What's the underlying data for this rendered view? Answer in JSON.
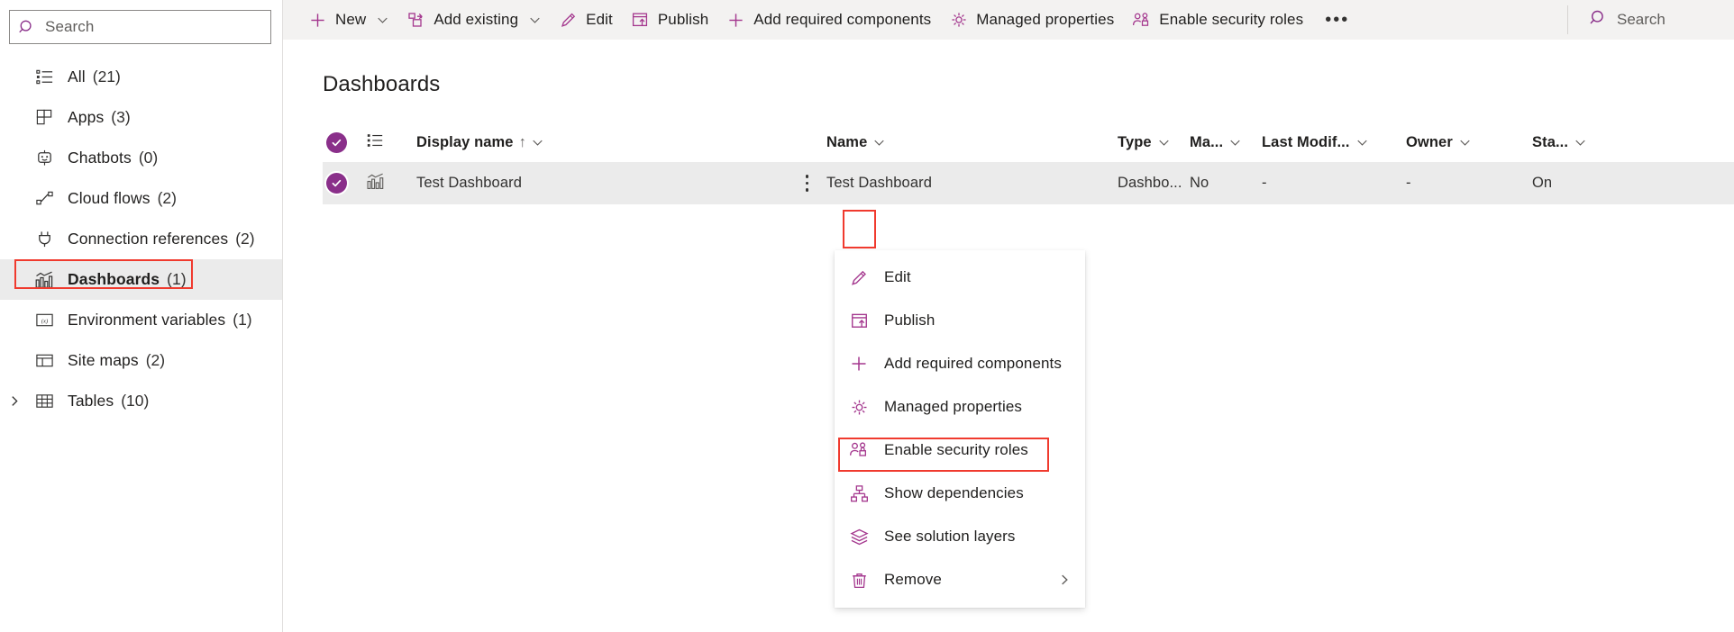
{
  "sidebar": {
    "search": {
      "placeholder": "Search",
      "icon": "search-icon"
    },
    "items": [
      {
        "label": "All",
        "count": "(21)",
        "icon": "list-icon"
      },
      {
        "label": "Apps",
        "count": "(3)",
        "icon": "apps-grid-icon"
      },
      {
        "label": "Chatbots",
        "count": "(0)",
        "icon": "chatbot-icon"
      },
      {
        "label": "Cloud flows",
        "count": "(2)",
        "icon": "cloud-flow-icon"
      },
      {
        "label": "Connection references",
        "count": "(2)",
        "icon": "plug-icon"
      },
      {
        "label": "Dashboards",
        "count": "(1)",
        "icon": "dashboard-chart-icon"
      },
      {
        "label": "Environment variables",
        "count": "(1)",
        "icon": "variable-icon"
      },
      {
        "label": "Site maps",
        "count": "(2)",
        "icon": "sitemap-layout-icon"
      },
      {
        "label": "Tables",
        "count": "(10)",
        "icon": "table-icon"
      }
    ],
    "selected_index": 5,
    "expandable_index": 8
  },
  "commandbar": {
    "items": [
      {
        "label": "New",
        "icon": "plus-icon",
        "caret": true
      },
      {
        "label": "Add existing",
        "icon": "add-existing-icon",
        "caret": true
      },
      {
        "label": "Edit",
        "icon": "pencil-icon",
        "caret": false
      },
      {
        "label": "Publish",
        "icon": "publish-icon",
        "caret": false
      },
      {
        "label": "Add required components",
        "icon": "plus-icon",
        "caret": false
      },
      {
        "label": "Managed properties",
        "icon": "gear-icon",
        "caret": false
      },
      {
        "label": "Enable security roles",
        "icon": "security-roles-icon",
        "caret": false
      }
    ],
    "overflow_label": "•••",
    "search": {
      "placeholder": "Search",
      "icon": "search-icon"
    }
  },
  "page": {
    "title": "Dashboards"
  },
  "grid": {
    "columns": [
      {
        "key": "display_name",
        "label": "Display name",
        "sorted": "↑"
      },
      {
        "key": "name",
        "label": "Name"
      },
      {
        "key": "type",
        "label": "Type"
      },
      {
        "key": "managed",
        "label": "Ma..."
      },
      {
        "key": "last_modified",
        "label": "Last Modif..."
      },
      {
        "key": "owner",
        "label": "Owner"
      },
      {
        "key": "status",
        "label": "Sta..."
      }
    ],
    "rows": [
      {
        "display_name": "Test Dashboard",
        "name": "Test Dashboard",
        "type": "Dashbo...",
        "managed": "No",
        "last_modified": "-",
        "owner": "-",
        "status": "On",
        "selected": true,
        "row_icon": "dashboard-chart-icon"
      }
    ]
  },
  "context_menu": {
    "items": [
      {
        "label": "Edit",
        "icon": "pencil-icon",
        "submenu": false
      },
      {
        "label": "Publish",
        "icon": "publish-icon",
        "submenu": false
      },
      {
        "label": "Add required components",
        "icon": "plus-icon",
        "submenu": false
      },
      {
        "label": "Managed properties",
        "icon": "gear-icon",
        "submenu": false
      },
      {
        "label": "Enable security roles",
        "icon": "security-roles-icon",
        "submenu": false,
        "highlighted": true
      },
      {
        "label": "Show dependencies",
        "icon": "dependencies-icon",
        "submenu": false
      },
      {
        "label": "See solution layers",
        "icon": "layers-icon",
        "submenu": false
      },
      {
        "label": "Remove",
        "icon": "trash-icon",
        "submenu": true
      }
    ]
  },
  "colors": {
    "accent_purple": "#8a2f8a",
    "icon_purple": "#a4378e",
    "highlight_red": "#f03a2e",
    "row_selected_bg": "#ebebeb",
    "commandbar_bg": "#f3f2f1",
    "text_primary": "#201f1e",
    "text_secondary": "#605e5c"
  }
}
